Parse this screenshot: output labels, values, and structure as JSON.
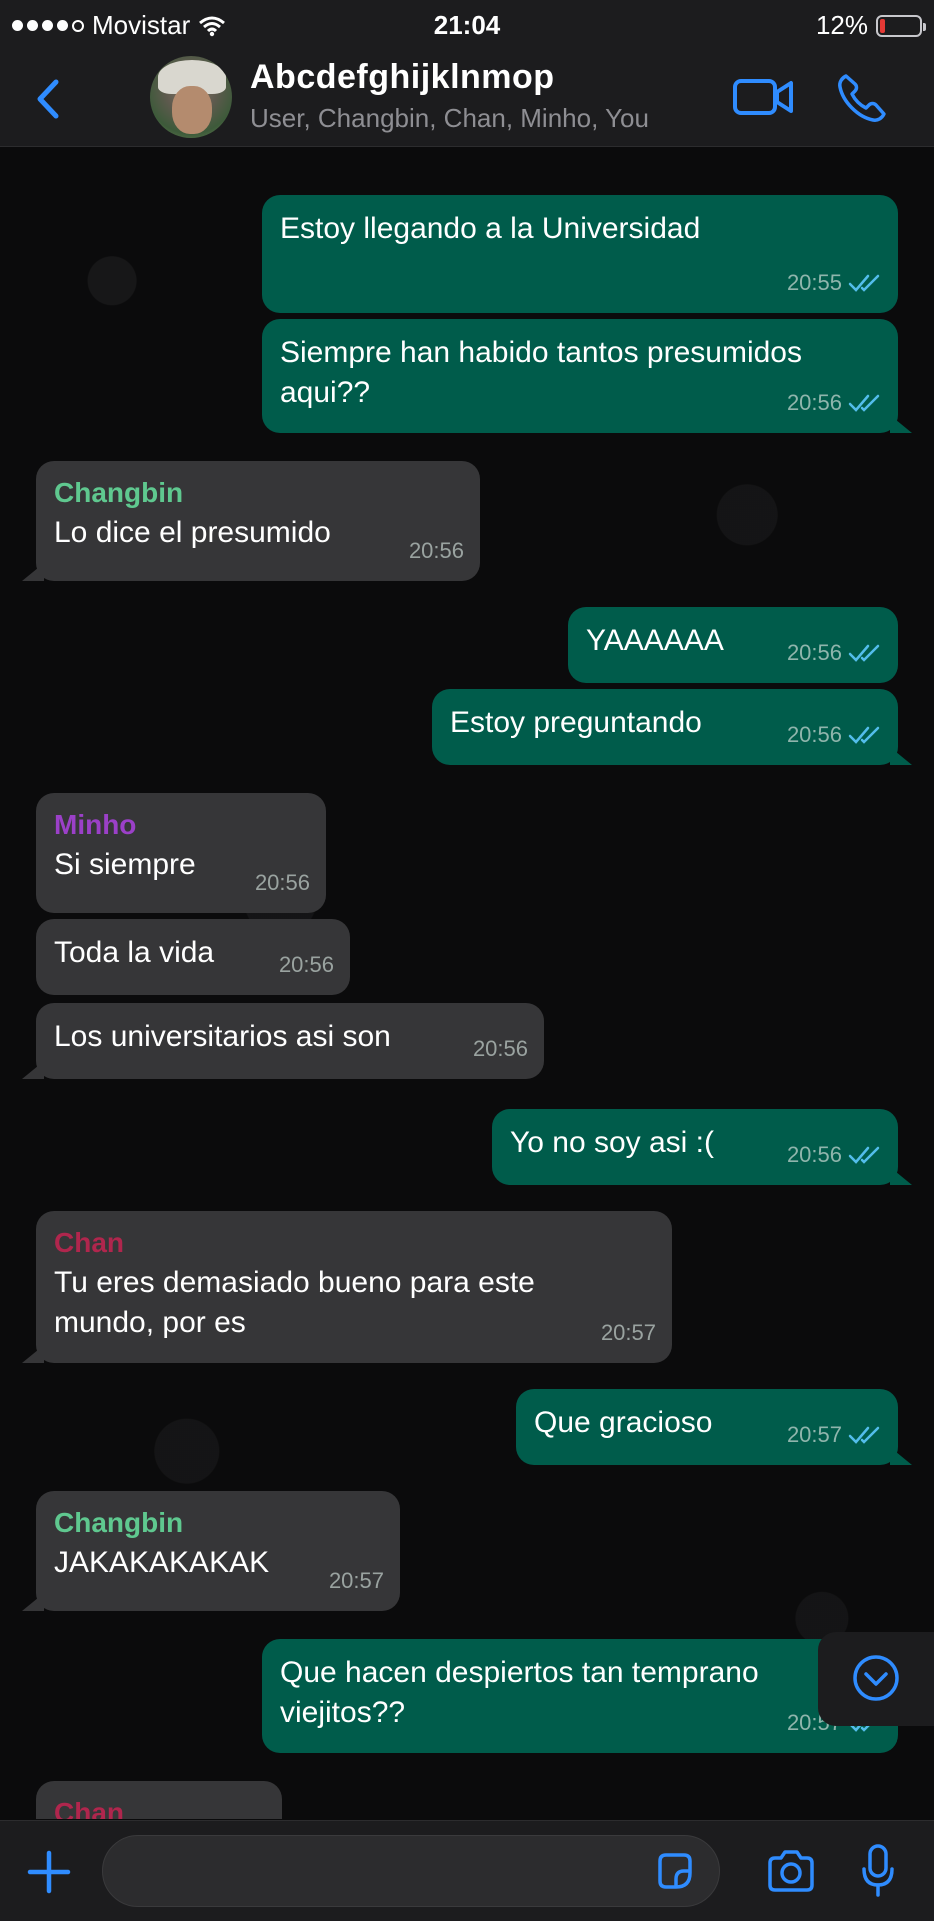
{
  "status_bar": {
    "carrier": "Movistar",
    "time": "21:04",
    "battery": "12%",
    "battery_level": 0.12,
    "signal_bars": 4,
    "signal_total": 5,
    "battery_color": "#e53935"
  },
  "header": {
    "title": "Abcdefghijklnmop",
    "subtitle": "User, Changbin, Chan, Minho, You",
    "icons": [
      "back-chevron-icon",
      "video-camera-icon",
      "phone-icon"
    ],
    "accent_color": "#2f8cff"
  },
  "messages": [
    {
      "direction": "out",
      "text": "Estoy llegando a la Universidad",
      "time": "20:55",
      "read": true
    },
    {
      "direction": "out",
      "text": "Siempre han habido tantos presumidos aqui??",
      "time": "20:56",
      "read": true
    },
    {
      "direction": "in",
      "sender": "Changbin",
      "sender_color": "#5fc88f",
      "text": "Lo dice el presumido",
      "time": "20:56"
    },
    {
      "direction": "out",
      "text": "YAAAAAA",
      "time": "20:56",
      "read": true
    },
    {
      "direction": "out",
      "text": "Estoy preguntando",
      "time": "20:56",
      "read": true
    },
    {
      "direction": "in",
      "sender": "Minho",
      "sender_color": "#9b40c8",
      "text": "Si siempre",
      "time": "20:56"
    },
    {
      "direction": "in",
      "text": "Toda la vida",
      "time": "20:56"
    },
    {
      "direction": "in",
      "text": "Los universitarios asi son",
      "time": "20:56"
    },
    {
      "direction": "out",
      "text": "Yo no soy asi :(",
      "time": "20:56",
      "read": true
    },
    {
      "direction": "in",
      "sender": "Chan",
      "sender_color": "#b0264d",
      "text": "Tu eres demasiado bueno para este mundo, por es",
      "time": "20:57"
    },
    {
      "direction": "out",
      "text": "Que gracioso",
      "time": "20:57",
      "read": true
    },
    {
      "direction": "in",
      "sender": "Changbin",
      "sender_color": "#5fc88f",
      "text": "JAKAKAKAKAK",
      "time": "20:57"
    },
    {
      "direction": "out",
      "text": "Que hacen despiertos tan temprano viejitos??",
      "time": "20:57",
      "read": true
    },
    {
      "direction": "in",
      "sender": "Chan",
      "sender_color": "#b0264d",
      "text": "",
      "time": ""
    }
  ],
  "input": {
    "value": "",
    "placeholder": ""
  },
  "colors": {
    "outgoing_bubble": "#005c4b",
    "incoming_bubble": "#363638",
    "read_ticks": "#53bdeb"
  }
}
